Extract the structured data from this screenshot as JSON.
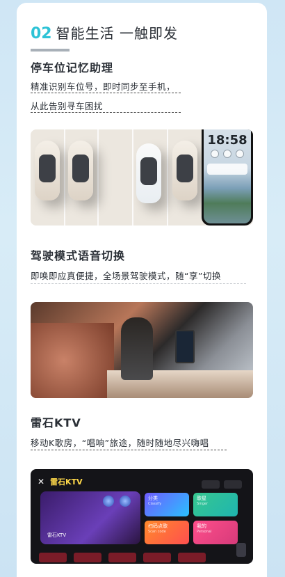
{
  "section": {
    "number": "02",
    "title": "智能生活  一触即发"
  },
  "features": [
    {
      "title": "停车位记忆助理",
      "desc_line1": "精准识别车位号，即时同步至手机，",
      "desc_line2": "从此告别寻车困扰"
    },
    {
      "title": "驾驶模式语音切换",
      "desc_line1": "即唤即应真便捷，全场景驾驶模式，随“享”切换"
    },
    {
      "title": "雷石KTV",
      "desc_line1": "移动K歌房，“唱响”旅途，随时随地尽兴嗨唱"
    }
  ],
  "phone": {
    "time": "18:58"
  },
  "ktv_app": {
    "logo": "雷石KTV",
    "hero_label": "雷石KTV",
    "tiles": [
      {
        "label": "分类",
        "sub": "Classify"
      },
      {
        "label": "歌星",
        "sub": "Singer"
      },
      {
        "label": "扫码点歌",
        "sub": "Scan code"
      },
      {
        "label": "我的",
        "sub": "Personal"
      }
    ]
  },
  "colors": {
    "accent": "#2ec3d6",
    "text": "#2a2f36",
    "bg": "#d8ecf7"
  }
}
